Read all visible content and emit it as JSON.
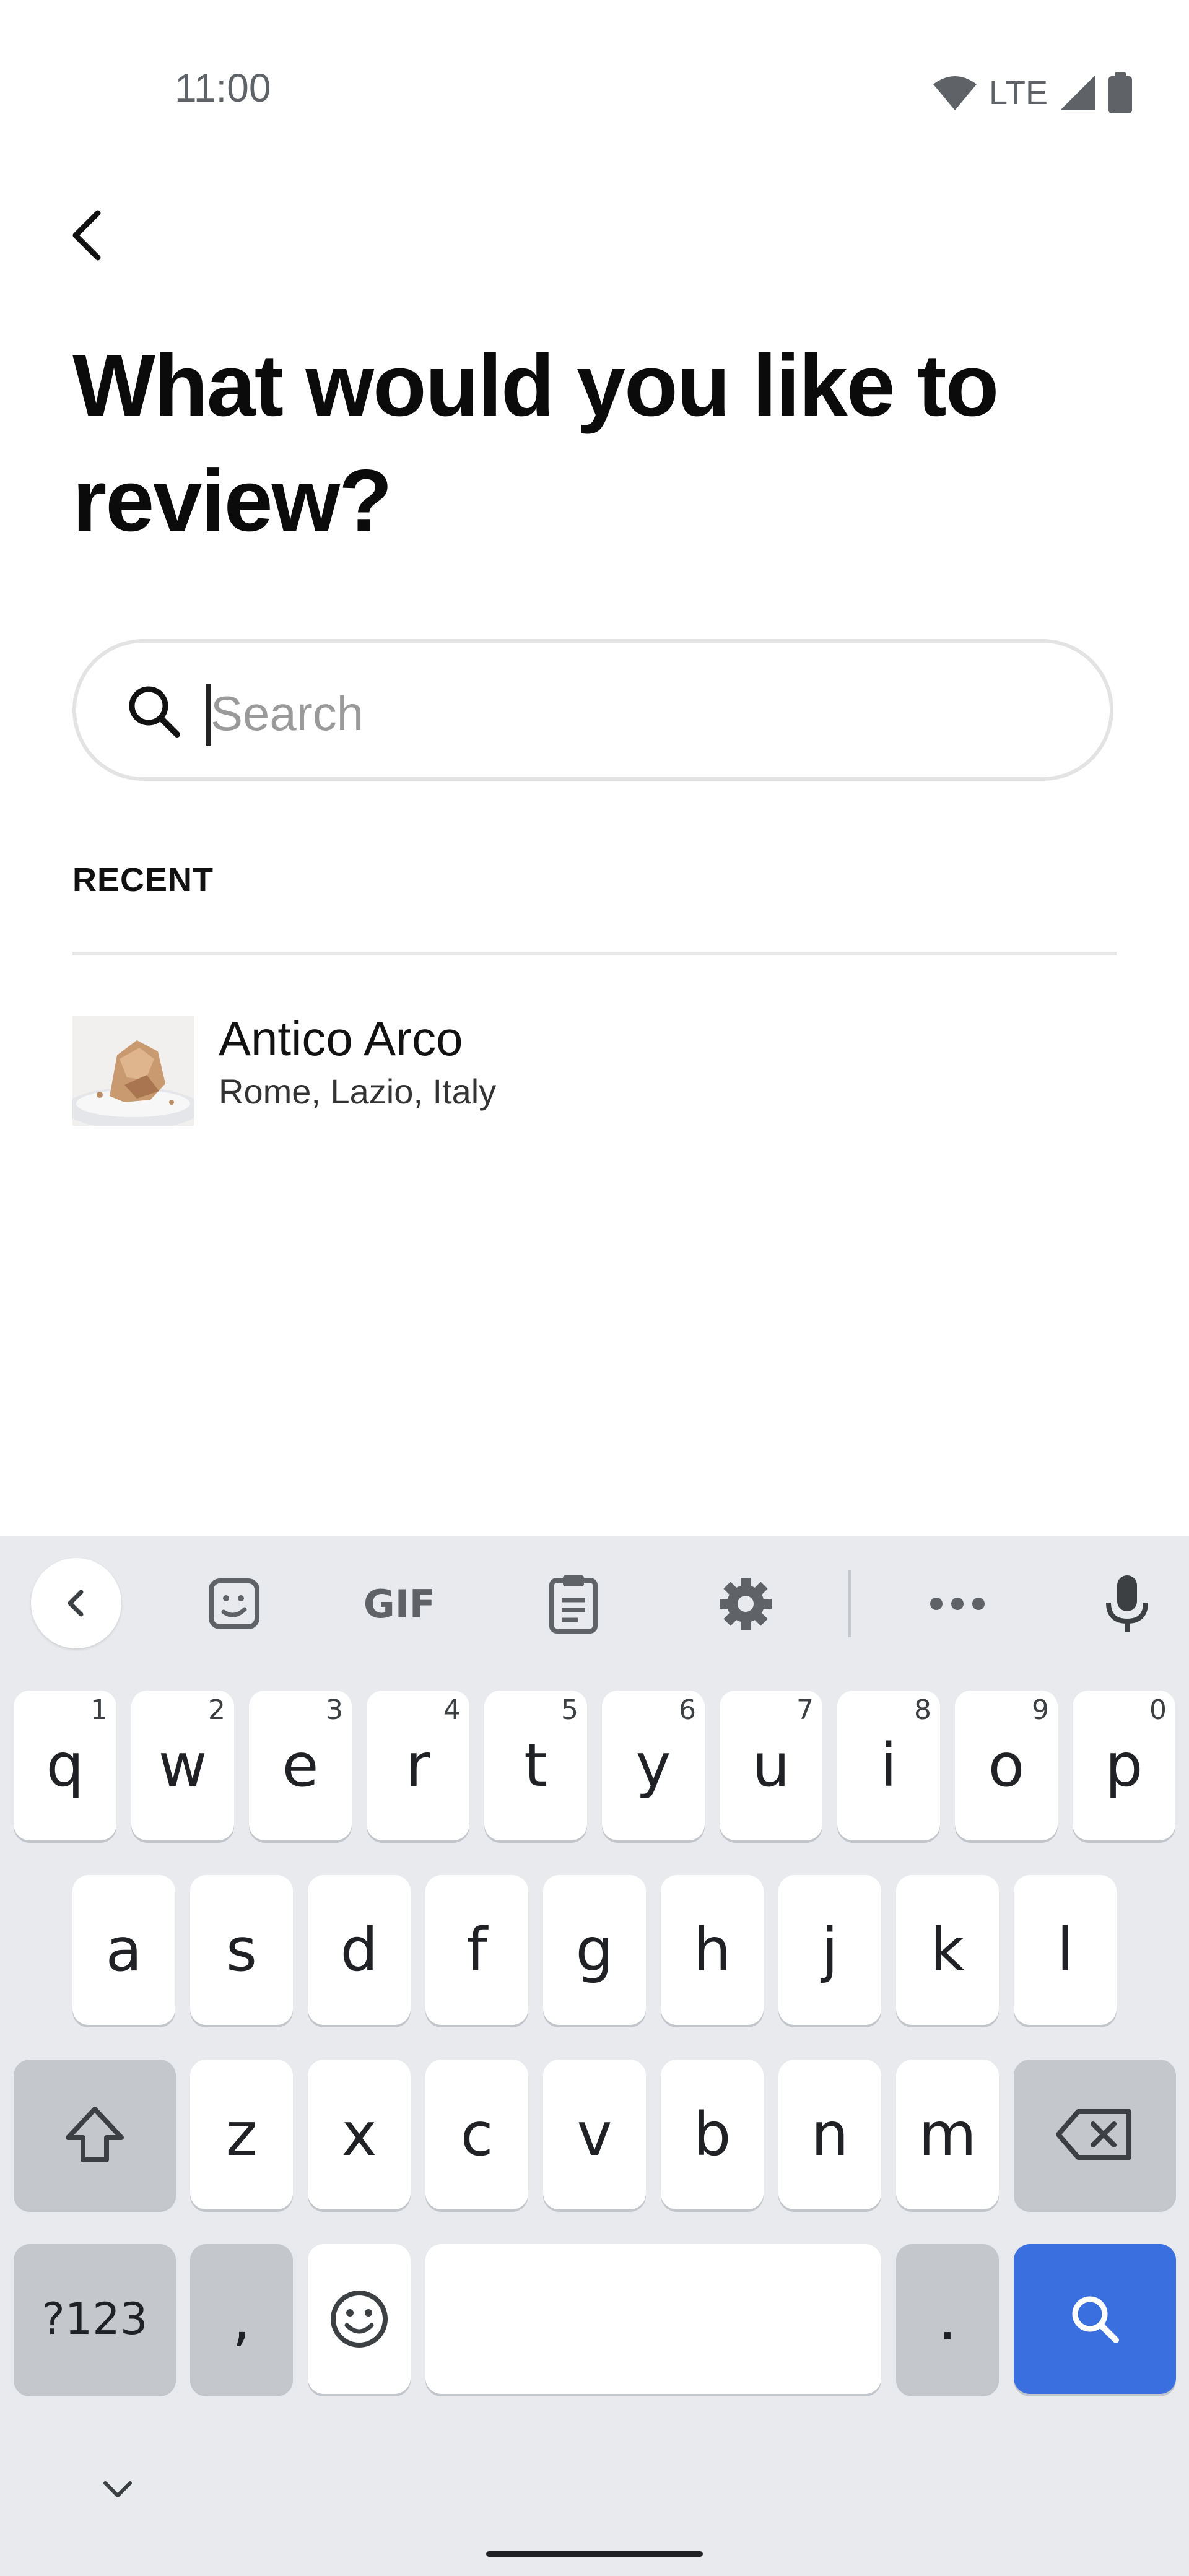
{
  "status_bar": {
    "time": "11:00",
    "network": "LTE",
    "icons": [
      "wifi-icon",
      "signal-icon",
      "battery-icon"
    ]
  },
  "header": {
    "back_icon": "chevron-left-icon",
    "title": "What would you like to review?"
  },
  "search": {
    "placeholder": "Search",
    "value": "",
    "icon": "search-icon"
  },
  "recent": {
    "heading": "RECENT",
    "items": [
      {
        "name": "Antico Arco",
        "location": "Rome, Lazio, Italy"
      }
    ]
  },
  "keyboard": {
    "toolbar": [
      "chevron-left-icon",
      "sticker-icon",
      "gif-icon",
      "clipboard-icon",
      "gear-icon",
      "more-icon",
      "mic-icon"
    ],
    "gif_label": "GIF",
    "row1": [
      {
        "key": "q",
        "hint": "1"
      },
      {
        "key": "w",
        "hint": "2"
      },
      {
        "key": "e",
        "hint": "3"
      },
      {
        "key": "r",
        "hint": "4"
      },
      {
        "key": "t",
        "hint": "5"
      },
      {
        "key": "y",
        "hint": "6"
      },
      {
        "key": "u",
        "hint": "7"
      },
      {
        "key": "i",
        "hint": "8"
      },
      {
        "key": "o",
        "hint": "9"
      },
      {
        "key": "p",
        "hint": "0"
      }
    ],
    "row2": [
      "a",
      "s",
      "d",
      "f",
      "g",
      "h",
      "j",
      "k",
      "l"
    ],
    "row3": [
      "z",
      "x",
      "c",
      "v",
      "b",
      "n",
      "m"
    ],
    "symbols_label": "?123",
    "comma": ",",
    "period": ".",
    "accent_color": "#3a6fe0"
  }
}
